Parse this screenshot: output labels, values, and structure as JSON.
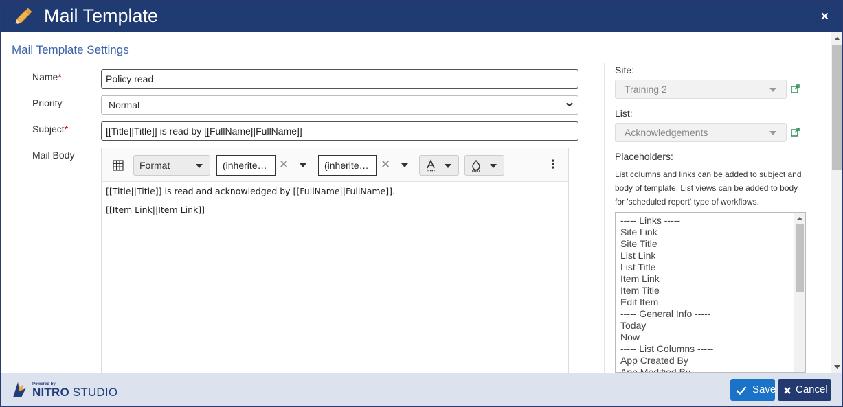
{
  "dialog": {
    "title": "Mail Template",
    "close_label": "×"
  },
  "section_title": "Mail Template Settings",
  "form": {
    "name_label": "Name",
    "name_value": "Policy read",
    "priority_label": "Priority",
    "priority_value": "Normal",
    "subject_label": "Subject",
    "subject_value": "[[Title||Title]] is read by [[FullName||FullName]]",
    "body_label": "Mail Body",
    "required_mark": "*"
  },
  "editor": {
    "toolbar": {
      "format_label": "Format",
      "font_family_value": "(inherite…",
      "font_size_value": "(inherite…",
      "clear_symbol": "✕",
      "more_symbol": "⋮"
    },
    "lines": [
      "[[Title||Title]] is read and acknowledged by [[FullName||FullName]].",
      "[[Item Link||Item Link]]"
    ]
  },
  "sidebar": {
    "site_label": "Site:",
    "site_value": "Training 2",
    "list_label": "List:",
    "list_value": "Acknowledgements",
    "placeholders_label": "Placeholders:",
    "note": "List columns and links can be added to subject and body of template. List views can be added to body for 'scheduled report' type of workflows.",
    "placeholders": [
      "----- Links -----",
      "Site Link",
      "Site Title",
      "List Link",
      "List Title",
      "Item Link",
      "Item Title",
      "Edit Item",
      "----- General Info -----",
      "Today",
      "Now",
      "----- List Columns -----",
      "App Created By",
      "App Modified By"
    ]
  },
  "footer": {
    "powered_by": "Powered by",
    "brand_bold": "NITRO",
    "brand_rest": " STUDIO",
    "save_label": "Save",
    "cancel_label": "Cancel"
  },
  "colors": {
    "header": "#203a72",
    "section_title": "#3a63a8",
    "save": "#1a73c9",
    "cancel": "#223a70",
    "footer": "#dde3ee"
  }
}
